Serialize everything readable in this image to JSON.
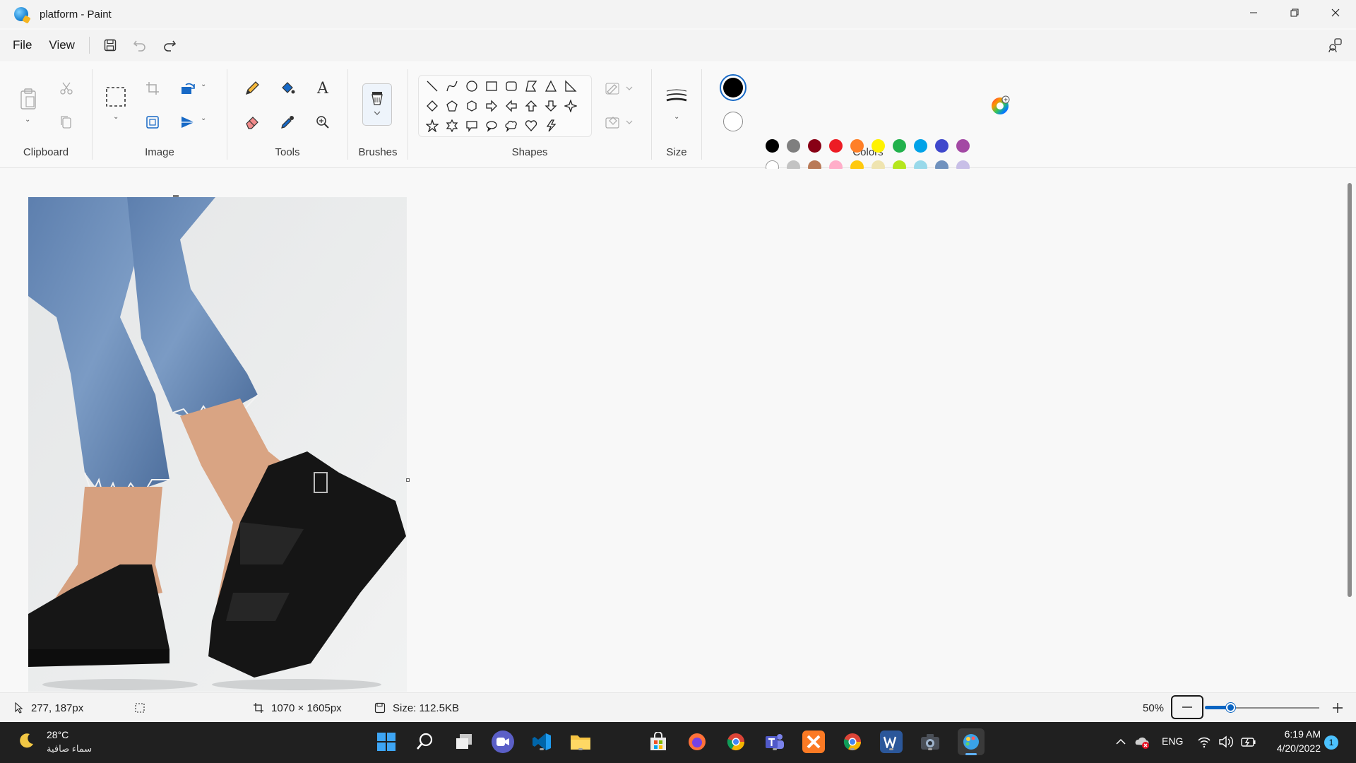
{
  "window": {
    "title": "platform - Paint"
  },
  "menu": {
    "file": "File",
    "view": "View"
  },
  "ribbon": {
    "groups": {
      "clipboard": "Clipboard",
      "image": "Image",
      "tools": "Tools",
      "brushes": "Brushes",
      "shapes": "Shapes",
      "size": "Size",
      "colors": "Colors"
    },
    "tool_text_glyph": "A"
  },
  "colors": {
    "primary": "#000000",
    "secondary": "#ffffff",
    "palette_row1": [
      "#000000",
      "#7f7f7f",
      "#880015",
      "#ed1c24",
      "#ff7f27",
      "#fff200",
      "#22b14c",
      "#00a2e8",
      "#3f48cc",
      "#a349a4"
    ],
    "palette_row2": [
      "#ffffff",
      "#c3c3c3",
      "#b97a57",
      "#ffaec9",
      "#ffc90e",
      "#efe4b0",
      "#b5e61d",
      "#99d9ea",
      "#7092be",
      "#c8bfe7"
    ],
    "palette_row3_empty_count": 10
  },
  "status": {
    "cursor_position": "277, 187px",
    "image_dimensions": "1070 × 1605px",
    "file_size": "Size: 112.5KB",
    "zoom_label": "50%",
    "zoom_fraction": 0.22
  },
  "taskbar": {
    "weather_temp": "28°C",
    "weather_desc": "سماء صافية",
    "language": "ENG",
    "time": "6:19 AM",
    "date": "4/20/2022",
    "notification_count": "1"
  }
}
